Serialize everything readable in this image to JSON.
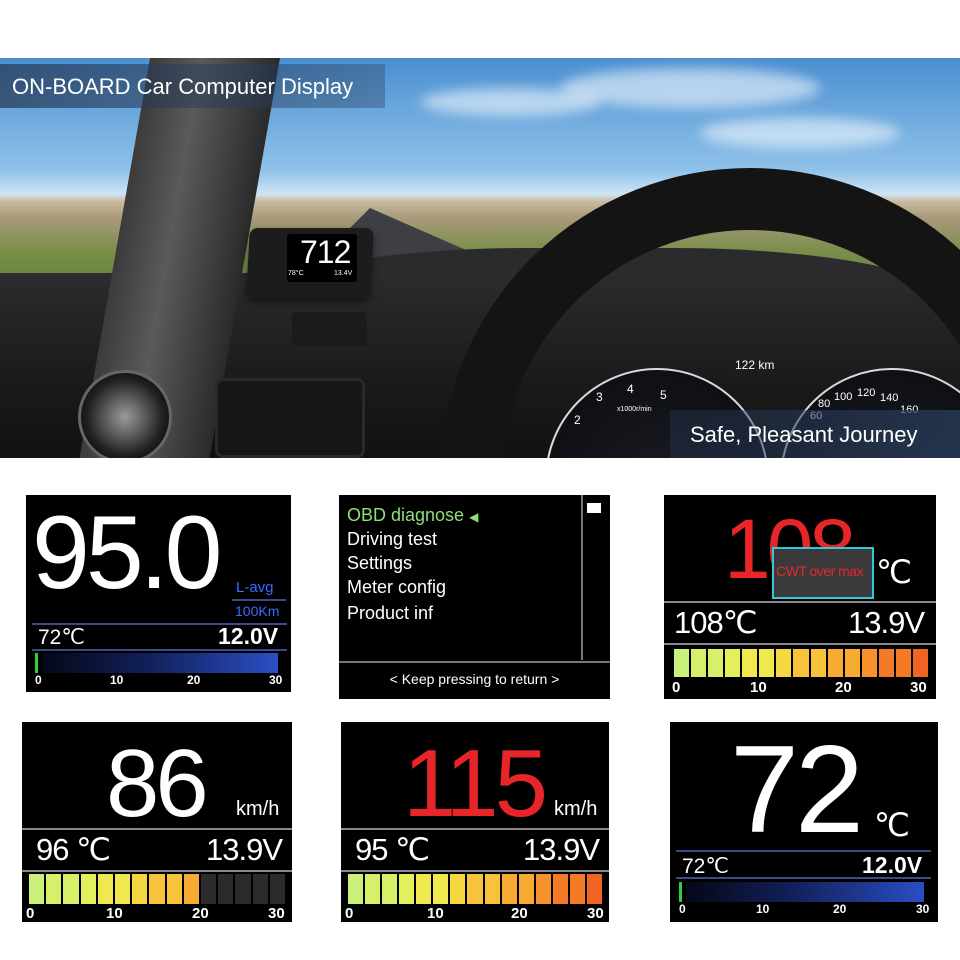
{
  "banner": {
    "title": "ON-BOARD Car Computer Display",
    "slogan": "Safe, Pleasant Journey",
    "device": {
      "main": "712",
      "temp": "78°C",
      "voltage": "13.4V"
    },
    "cluster_readout": "122 km",
    "tach_ticks": [
      "2",
      "3",
      "4",
      "5"
    ],
    "speedo_ticks": [
      "60",
      "80",
      "100",
      "120",
      "140",
      "160"
    ],
    "tach_unit": "x1000r/min"
  },
  "panel_fuel": {
    "value": "95.0",
    "unit_top": "L-avg",
    "unit_bottom": "100Km",
    "temp": "72℃",
    "voltage": "12.0V",
    "scale": [
      "0",
      "10",
      "20",
      "30"
    ],
    "level_fraction": 1.0
  },
  "panel_menu": {
    "items": [
      "OBD diagnose",
      "Driving test",
      "Settings",
      "Meter config",
      "Product  inf"
    ],
    "active_index": 0,
    "footer": "< Keep  pressing to return >"
  },
  "panel_warning": {
    "value": "108",
    "unit": "℃",
    "warning": "CWT over max",
    "temp": "108℃",
    "voltage": "13.9V",
    "scale": [
      "0",
      "10",
      "20",
      "30"
    ],
    "filled_segments": 15,
    "total_segments": 15
  },
  "panel_speed86": {
    "value": "86",
    "unit": "km/h",
    "temp": "96 ℃",
    "voltage": "13.9V",
    "scale": [
      "0",
      "10",
      "20",
      "30"
    ],
    "filled_segments": 10,
    "total_segments": 15
  },
  "panel_speed115": {
    "value": "115",
    "unit": "km/h",
    "temp": "95 ℃",
    "voltage": "13.9V",
    "scale": [
      "0",
      "10",
      "20",
      "30"
    ],
    "filled_segments": 15,
    "total_segments": 15
  },
  "panel_temp72": {
    "value": "72",
    "unit": "℃",
    "temp": "72℃",
    "voltage": "12.0V",
    "scale": [
      "0",
      "10",
      "20",
      "30"
    ],
    "level_fraction": 1.0
  },
  "colors": {
    "menu_active": "#8fe07a",
    "alert_red": "#e8262a",
    "warning_border": "#36c7d6",
    "segment_palette": [
      "#c9f07a",
      "#d6f06a",
      "#e4ef5c",
      "#efe84f",
      "#f5d742",
      "#f7c33a",
      "#f8ab32",
      "#f7922c",
      "#f47a27",
      "#f06423"
    ]
  }
}
